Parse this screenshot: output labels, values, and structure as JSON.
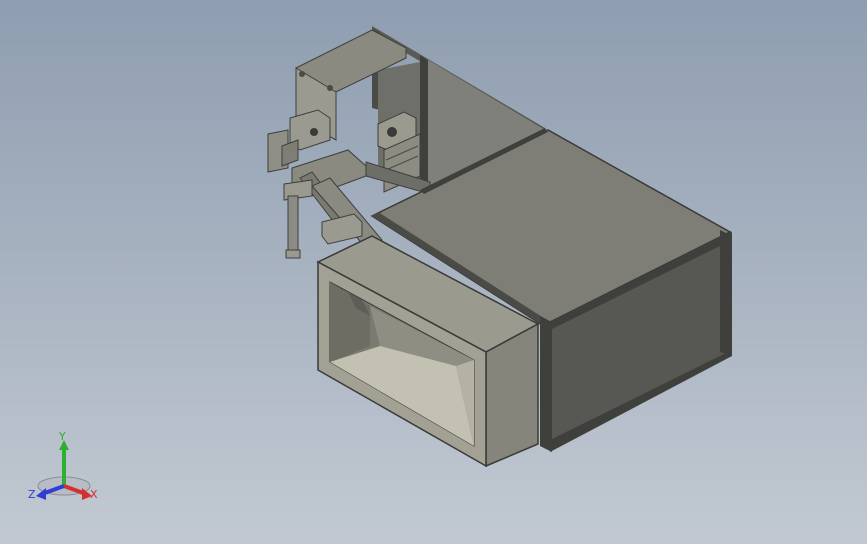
{
  "viewport": {
    "background_top": "#8e9db0",
    "background_bottom": "#c2c9d2"
  },
  "model": {
    "body_color": "#8a8a80",
    "body_dark": "#5b5b55",
    "frame_color": "#4a4a48",
    "panel_color": "#7e7e76",
    "duct_inner": "#b9b8a8"
  },
  "triad": {
    "x_label": "X",
    "y_label": "Y",
    "z_label": "Z",
    "x_color": "#d43030",
    "y_color": "#2fae2f",
    "z_color": "#2f3fd4"
  }
}
